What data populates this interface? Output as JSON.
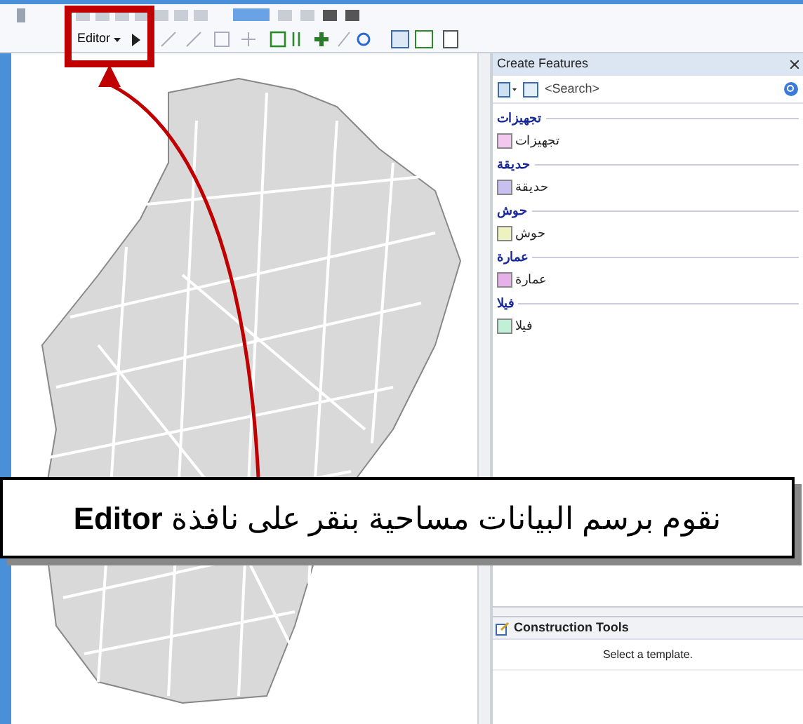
{
  "toolbar": {
    "editor_menu": "Editor"
  },
  "create_features": {
    "title": "Create Features",
    "search": {
      "placeholder": "<Search>"
    },
    "groups": [
      {
        "header": "تجهيزات",
        "item": "تجهيزات",
        "color": "#f2c8ee"
      },
      {
        "header": "حديقة",
        "item": "حديقة",
        "color": "#c8c0f0"
      },
      {
        "header": "حوش",
        "item": "حوش",
        "color": "#eef2c0"
      },
      {
        "header": "عمارة",
        "item": "عمارة",
        "color": "#e6b0e8"
      },
      {
        "header": "فيلا",
        "item": "فيلا",
        "color": "#c0f0d8"
      }
    ]
  },
  "construction_tools": {
    "title": "Construction Tools",
    "message": "Select a template."
  },
  "callout": {
    "text": "نقوم برسم البيانات مساحية  بنقر على نافذة **Editor**"
  }
}
